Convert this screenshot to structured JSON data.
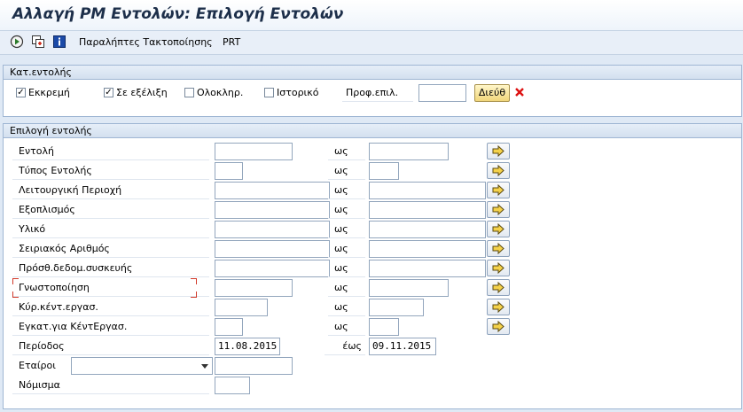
{
  "window": {
    "title": "Αλλαγή PM Εντολών: Επιλογή Εντολών"
  },
  "toolbar": {
    "execute_icon": "execute-icon",
    "copy_icon": "copy-icon",
    "info_icon": "info-icon",
    "params_label": "Παραλήπτες Τακτοποίησης",
    "prt_label": "PRT"
  },
  "status_group": {
    "title": "Κατ.εντολής",
    "checkboxes": [
      {
        "label": "Εκκρεμή",
        "checked": true
      },
      {
        "label": "Σε εξέλιξη",
        "checked": true
      },
      {
        "label": "Ολοκληρ.",
        "checked": false
      },
      {
        "label": "Ιστορικό",
        "checked": false
      }
    ],
    "profile_label": "Προφ.επιλ.",
    "profile_value": "",
    "address_button": "Διεύθ",
    "delete_icon": "delete-icon"
  },
  "selection_group": {
    "title": "Επιλογή εντολής",
    "to_label": "ως",
    "rows": [
      {
        "label": "Εντολή",
        "from": "",
        "to": ""
      },
      {
        "label": "Τύπος Εντολής",
        "from": "",
        "to": ""
      },
      {
        "label": "Λειτουργική Περιοχή",
        "from": "",
        "to": ""
      },
      {
        "label": "Εξοπλισμός",
        "from": "",
        "to": ""
      },
      {
        "label": "Υλικό",
        "from": "",
        "to": ""
      },
      {
        "label": "Σειριακός Αριθμός",
        "from": "",
        "to": ""
      },
      {
        "label": "Πρόσθ.δεδομ.συσκευής",
        "from": "",
        "to": ""
      },
      {
        "label": "Γνωστοποίηση",
        "from": "",
        "to": ""
      },
      {
        "label": "Κύρ.κέντ.εργασ.",
        "from": "",
        "to": ""
      },
      {
        "label": "Εγκατ.για ΚέντΕργασ.",
        "from": "",
        "to": ""
      }
    ],
    "period": {
      "label": "Περίοδος",
      "from": "11.08.2015",
      "to_label": "έως",
      "to": "09.11.2015"
    },
    "partners": {
      "label": "Εταίροι",
      "role": "",
      "value": ""
    },
    "currency": {
      "label": "Νόμισμα",
      "value": ""
    },
    "more_icon": "multiple-selection-icon"
  }
}
